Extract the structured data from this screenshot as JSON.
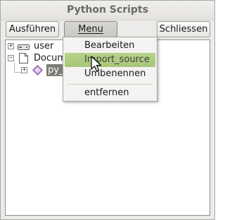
{
  "window": {
    "title": "Python Scripts"
  },
  "toolbar": {
    "run_label": "Ausführen",
    "menu_label": "Menu",
    "close_label": "Schliessen"
  },
  "tree": {
    "items": [
      {
        "label": "user",
        "icon": "drive-icon",
        "expander": "+"
      },
      {
        "label": "Docum",
        "icon": "document-icon",
        "expander": "−"
      },
      {
        "label": "py_",
        "icon": "script-diamond-icon",
        "expander": "+"
      }
    ]
  },
  "menu": {
    "items": [
      {
        "label": "Bearbeiten"
      },
      {
        "label": "Import_source"
      },
      {
        "label": "Umbenennen"
      },
      {
        "label": "entfernen"
      }
    ],
    "highlighted_index": 1,
    "highlight_color": "#a8c878"
  }
}
